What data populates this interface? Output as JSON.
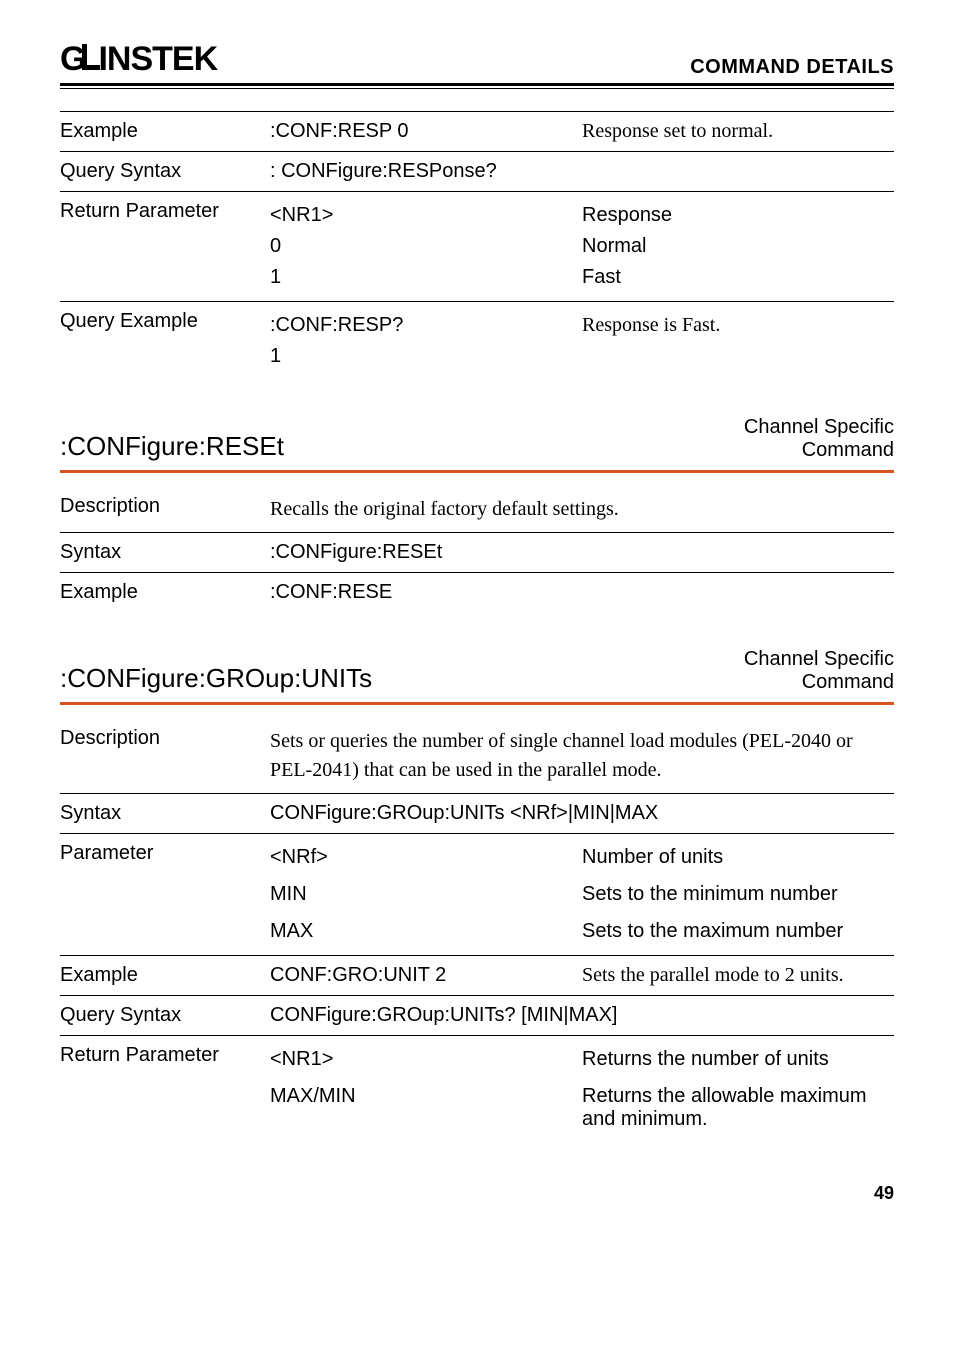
{
  "header": {
    "logo_part1": "G",
    "logo_part2": "INSTEK",
    "title": "COMMAND DETAILS"
  },
  "top_table": {
    "example_label": "Example",
    "example_cmd": ":CONF:RESP 0",
    "example_desc": "Response set to normal.",
    "query_syntax_label": "Query Syntax",
    "query_syntax_val": ": CONFigure:RESPonse?",
    "return_param_label": "Return Parameter",
    "return_param_type": "<NR1>",
    "return_param_head": "Response",
    "rp_rows": [
      {
        "v": "0",
        "d": "Normal"
      },
      {
        "v": "1",
        "d": "Fast"
      }
    ],
    "query_example_label": "Query Example",
    "query_example_cmd": ":CONF:RESP?",
    "query_example_cmd2": "1",
    "query_example_desc": "Response is Fast."
  },
  "sec_reset": {
    "title": ":CONFigure:RESEt",
    "badge1": "Channel Specific",
    "badge2": "Command",
    "desc_label": "Description",
    "desc_text": "Recalls the original factory default settings.",
    "syntax_label": "Syntax",
    "syntax_val": ":CONFigure:RESEt",
    "example_label": "Example",
    "example_val": ":CONF:RESE"
  },
  "sec_group": {
    "title": ":CONFigure:GROup:UNITs",
    "badge1": "Channel Specific",
    "badge2": "Command",
    "desc_label": "Description",
    "desc_text": "Sets or queries the number of single channel load modules (PEL-2040 or PEL-2041) that can be used in the parallel mode.",
    "syntax_label": "Syntax",
    "syntax_val": "CONFigure:GROup:UNITs <NRf>|MIN|MAX",
    "param_label": "Parameter",
    "params": [
      {
        "v": "<NRf>",
        "d": "Number of units"
      },
      {
        "v": "MIN",
        "d": "Sets to the minimum number"
      },
      {
        "v": "MAX",
        "d": "Sets to the maximum number"
      }
    ],
    "example_label": "Example",
    "example_cmd": "CONF:GRO:UNIT 2",
    "example_desc": "Sets the parallel mode to 2 units.",
    "query_syntax_label": "Query Syntax",
    "query_syntax_val": "CONFigure:GROup:UNITs? [MIN|MAX]",
    "return_param_label": "Return Parameter",
    "rp": [
      {
        "v": "<NR1>",
        "d": "Returns the number of units"
      },
      {
        "v": "MAX/MIN",
        "d": "Returns the allowable maximum and minimum."
      }
    ]
  },
  "page": "49"
}
